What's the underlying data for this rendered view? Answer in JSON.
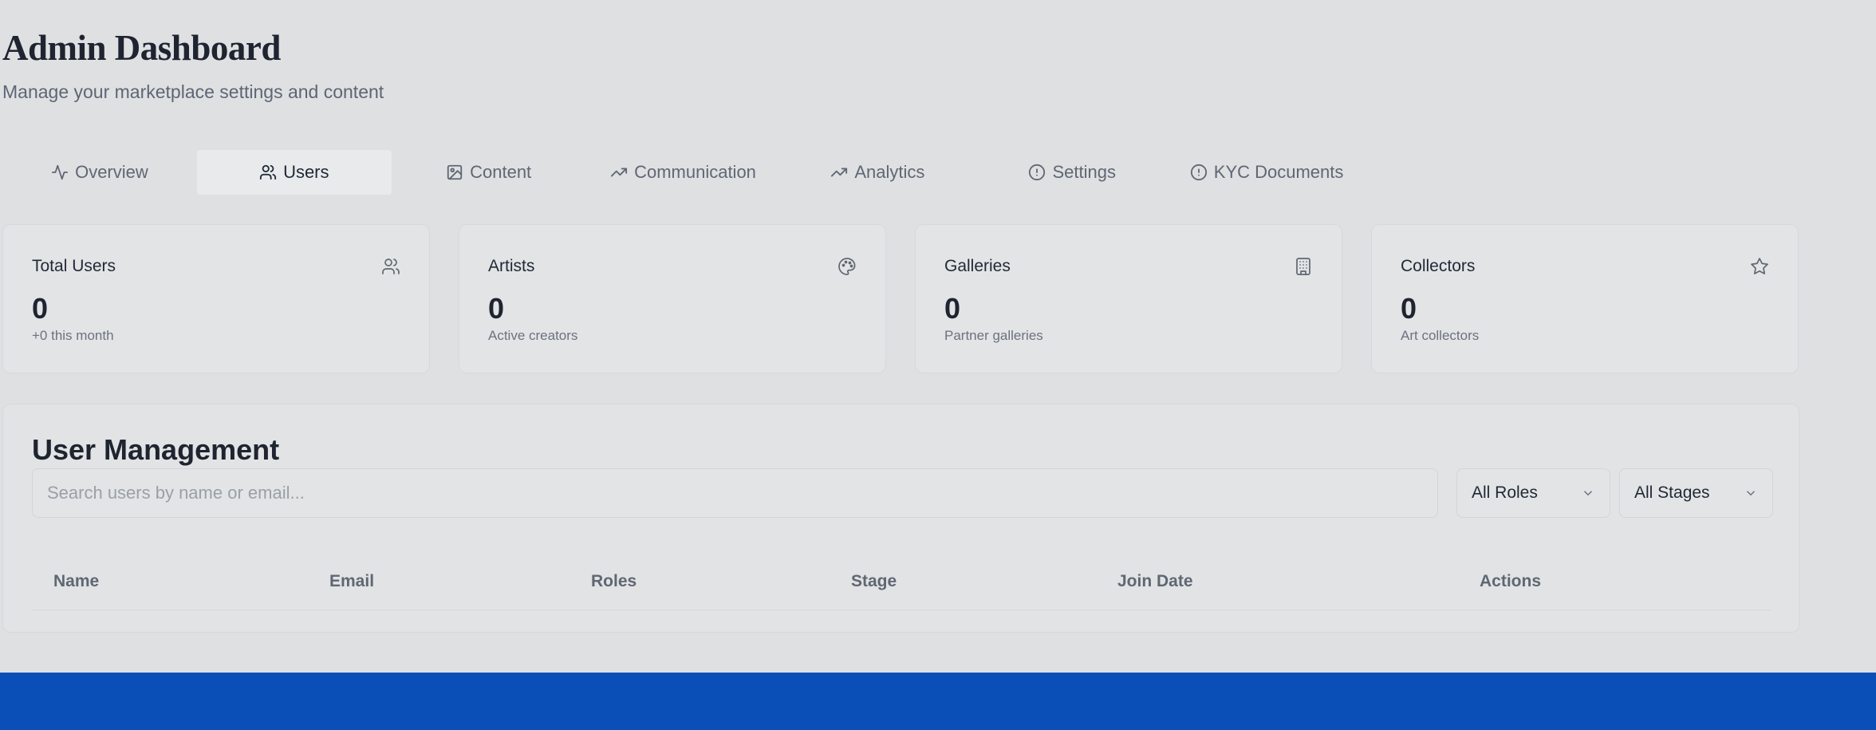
{
  "header": {
    "title": "Admin Dashboard",
    "subtitle": "Manage your marketplace settings and content"
  },
  "tabs": [
    {
      "label": "Overview",
      "icon": "activity-icon",
      "active": false
    },
    {
      "label": "Users",
      "icon": "users-icon",
      "active": true
    },
    {
      "label": "Content",
      "icon": "image-icon",
      "active": false
    },
    {
      "label": "Communication",
      "icon": "trending-up-icon",
      "active": false
    },
    {
      "label": "Analytics",
      "icon": "trending-up-icon",
      "active": false
    },
    {
      "label": "Settings",
      "icon": "alert-circle-icon",
      "active": false
    },
    {
      "label": "KYC Documents",
      "icon": "alert-circle-icon",
      "active": false
    }
  ],
  "stats": [
    {
      "label": "Total Users",
      "value": "0",
      "sub": "+0 this month",
      "icon": "users-icon"
    },
    {
      "label": "Artists",
      "value": "0",
      "sub": "Active creators",
      "icon": "palette-icon"
    },
    {
      "label": "Galleries",
      "value": "0",
      "sub": "Partner galleries",
      "icon": "building-icon"
    },
    {
      "label": "Collectors",
      "value": "0",
      "sub": "Art collectors",
      "icon": "star-icon"
    }
  ],
  "user_management": {
    "title": "User Management",
    "search_placeholder": "Search users by name or email...",
    "roles_filter": "All Roles",
    "stages_filter": "All Stages",
    "columns": [
      "Name",
      "Email",
      "Roles",
      "Stage",
      "Join Date",
      "Actions"
    ]
  },
  "colors": {
    "background": "#dfe0e2",
    "footer": "#0a4fb8",
    "text": "#1f2937",
    "muted": "#5f6774"
  }
}
